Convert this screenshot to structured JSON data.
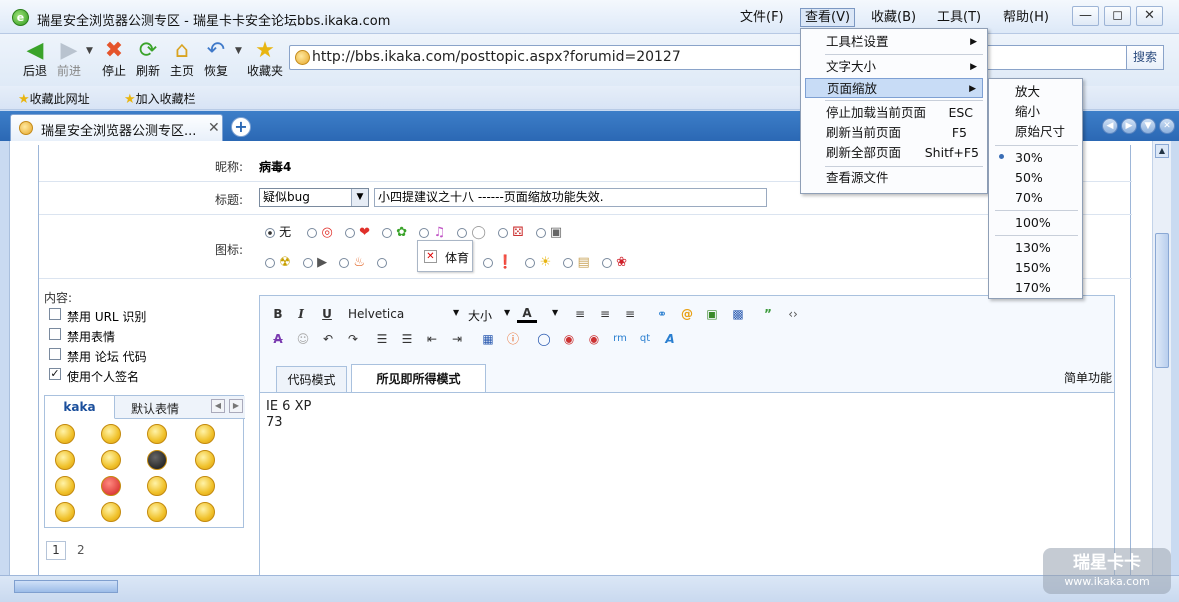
{
  "window": {
    "title": "瑞星安全浏览器公测专区 - 瑞星卡卡安全论坛bbs.ikaka.com",
    "menus": [
      "文件(F)",
      "查看(V)",
      "收藏(B)",
      "工具(T)",
      "帮助(H)"
    ],
    "logo_letter": "e"
  },
  "toolbar": {
    "back": "后退",
    "forward": "前进",
    "stop": "停止",
    "refresh": "刷新",
    "home": "主页",
    "restore": "恢复",
    "favorites": "收藏夹",
    "address": "http://bbs.ikaka.com/posttopic.aspx?forumid=20127",
    "search": "搜索"
  },
  "favbar": {
    "add_site": "收藏此网址",
    "add_to_bar": "加入收藏栏"
  },
  "tab": {
    "title": "瑞星安全浏览器公测专区..."
  },
  "form": {
    "nickname_label": "昵称:",
    "nickname_value": "病毒4",
    "title_label": "标题:",
    "category": "疑似bug",
    "title_value": "小四提建议之十八  ------页面缩放功能失效.",
    "icon_label": "图标:",
    "icon_none": "无",
    "tooltip": "体育",
    "content_label": "内容:",
    "options": [
      "禁用 URL 识别",
      "禁用表情",
      "禁用 论坛 代码",
      "使用个人签名"
    ],
    "options_checked": [
      false,
      false,
      false,
      true
    ],
    "smiley_tabs": [
      "kaka",
      "默认表情"
    ],
    "pages": [
      "1",
      "2"
    ]
  },
  "editor": {
    "font": "Helvetica",
    "size": "大小",
    "modes": [
      "代码模式",
      "所见即所得模式"
    ],
    "simple": "简单功能",
    "body_lines": [
      "IE 6  XP",
      "73"
    ]
  },
  "view_menu": {
    "items": [
      {
        "label": "工具栏设置",
        "submenu": true
      },
      {
        "label": "文字大小",
        "submenu": true
      },
      {
        "label": "页面缩放",
        "submenu": true,
        "highlighted": true
      },
      {
        "label": "停止加载当前页面",
        "shortcut": "ESC"
      },
      {
        "label": "刷新当前页面",
        "shortcut": "F5"
      },
      {
        "label": "刷新全部页面",
        "shortcut": "Shitf+F5"
      },
      {
        "label": "查看源文件"
      }
    ]
  },
  "zoom_menu": {
    "items": [
      "放大",
      "缩小",
      "原始尺寸",
      "30%",
      "50%",
      "70%",
      "100%",
      "130%",
      "150%",
      "170%"
    ],
    "selected": "30%"
  },
  "watermark": {
    "brand": "瑞星卡卡",
    "url": "www.ikaka.com"
  },
  "colors": {
    "tabbar": "#2b68b4",
    "menu_highlight": "#c8dcf6",
    "link_blue": "#1b4f9c"
  }
}
